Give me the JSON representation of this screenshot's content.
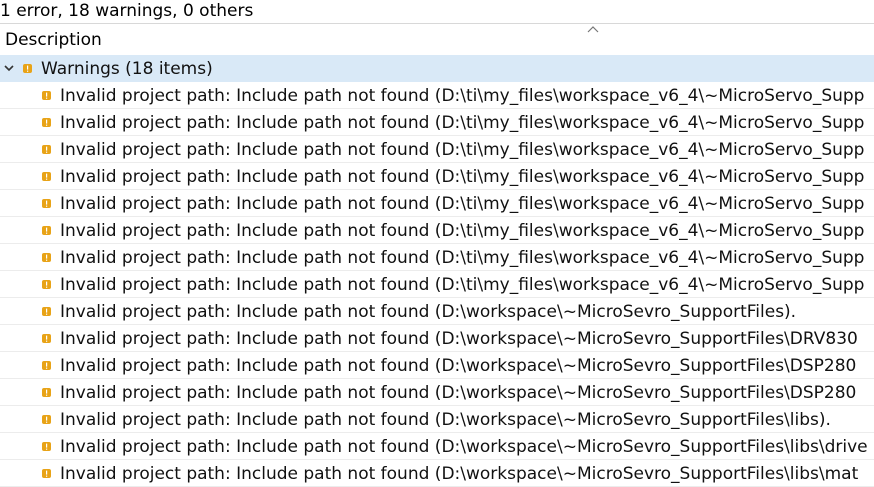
{
  "summary": "1 error, 18 warnings, 0 others",
  "header": {
    "description_label": "Description"
  },
  "group": {
    "label": "Warnings (18 items)"
  },
  "warnings": [
    "Invalid project path: Include path not found (D:\\ti\\my_files\\workspace_v6_4\\~MicroServo_Supp",
    "Invalid project path: Include path not found (D:\\ti\\my_files\\workspace_v6_4\\~MicroServo_Supp",
    "Invalid project path: Include path not found (D:\\ti\\my_files\\workspace_v6_4\\~MicroServo_Supp",
    "Invalid project path: Include path not found (D:\\ti\\my_files\\workspace_v6_4\\~MicroServo_Supp",
    "Invalid project path: Include path not found (D:\\ti\\my_files\\workspace_v6_4\\~MicroServo_Supp",
    "Invalid project path: Include path not found (D:\\ti\\my_files\\workspace_v6_4\\~MicroServo_Supp",
    "Invalid project path: Include path not found (D:\\ti\\my_files\\workspace_v6_4\\~MicroServo_Supp",
    "Invalid project path: Include path not found (D:\\ti\\my_files\\workspace_v6_4\\~MicroServo_Supp",
    "Invalid project path: Include path not found (D:\\workspace\\~MicroSevro_SupportFiles).",
    "Invalid project path: Include path not found (D:\\workspace\\~MicroSevro_SupportFiles\\DRV830",
    "Invalid project path: Include path not found (D:\\workspace\\~MicroSevro_SupportFiles\\DSP280",
    "Invalid project path: Include path not found (D:\\workspace\\~MicroSevro_SupportFiles\\DSP280",
    "Invalid project path: Include path not found (D:\\workspace\\~MicroSevro_SupportFiles\\libs).",
    "Invalid project path: Include path not found (D:\\workspace\\~MicroSevro_SupportFiles\\libs\\drive",
    "Invalid project path: Include path not found (D:\\workspace\\~MicroSevro_SupportFiles\\libs\\mat"
  ],
  "colors": {
    "selection": "#d9e9f7",
    "warning_icon": "#e8a317"
  }
}
